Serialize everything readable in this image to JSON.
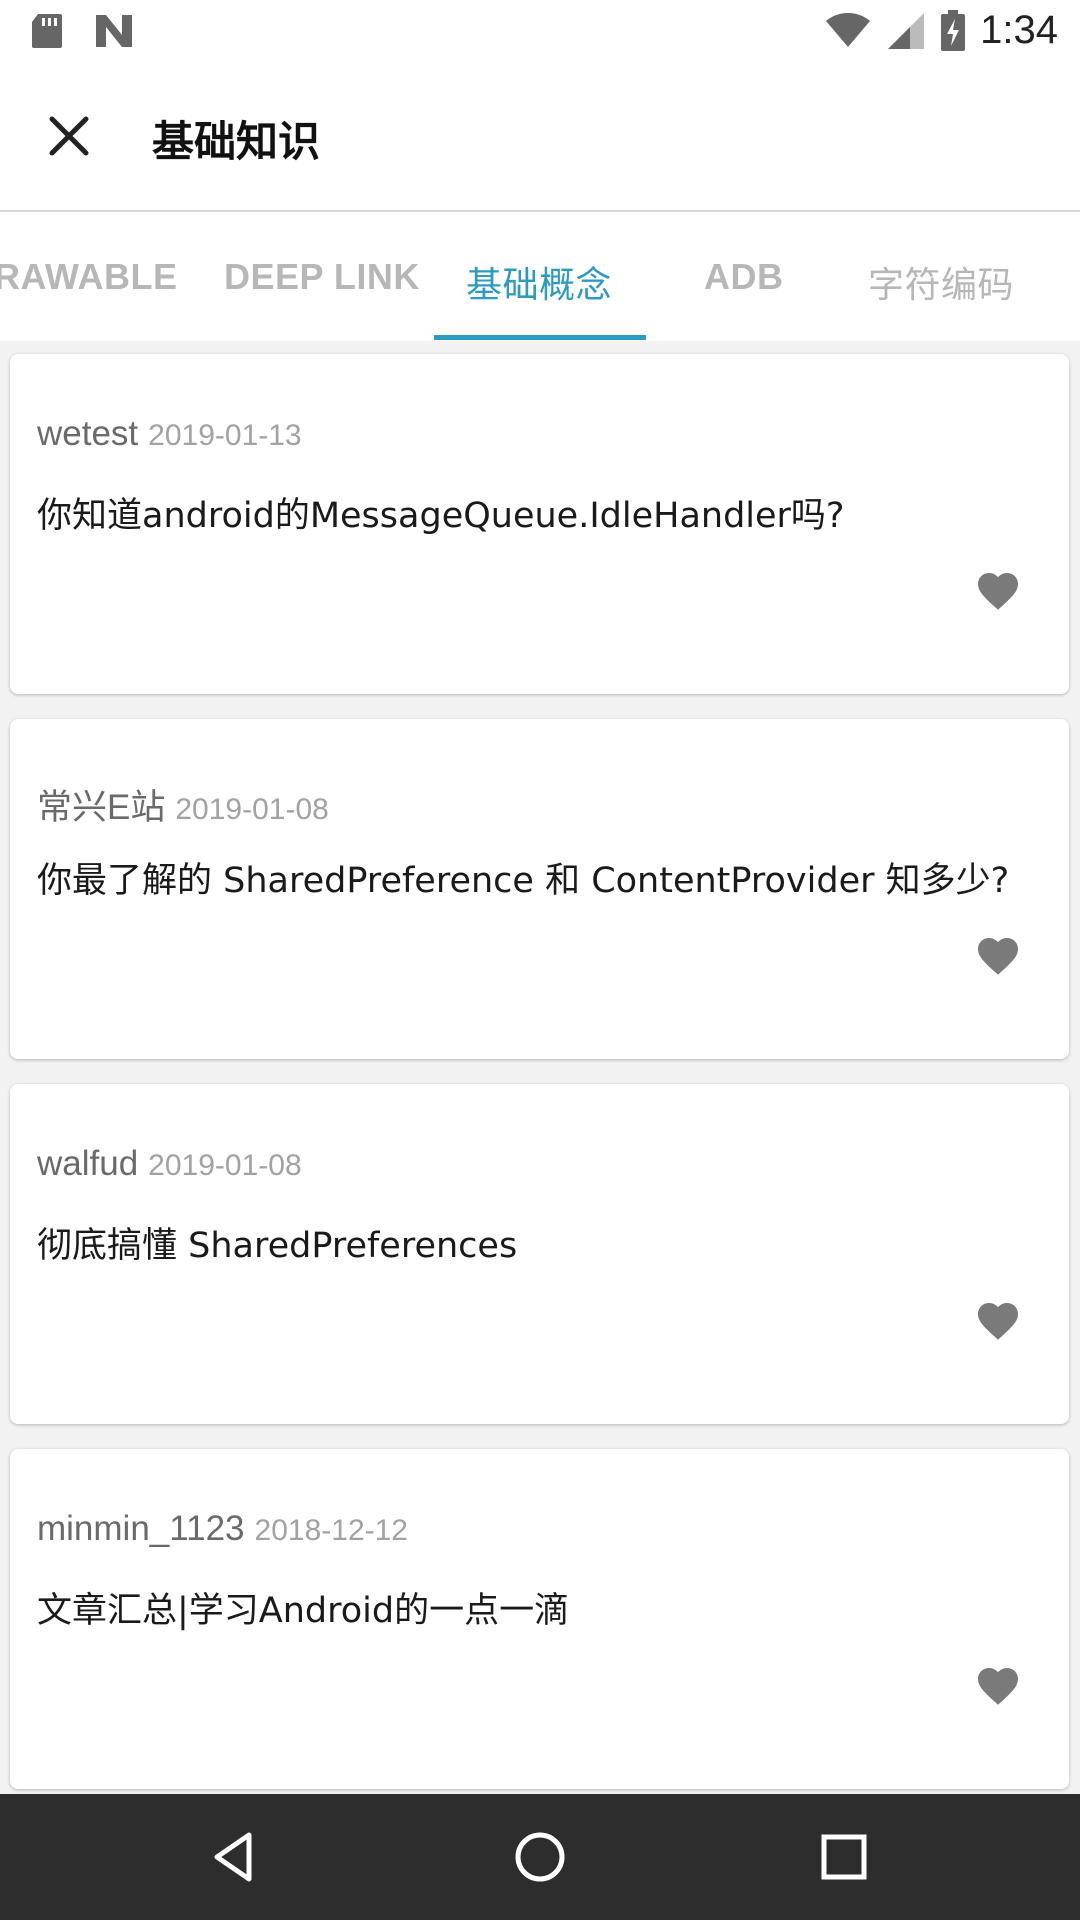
{
  "status_bar": {
    "time": "1:34",
    "icons": [
      "sd-card-icon",
      "n-logo-icon",
      "wifi-icon",
      "cell-signal-icon",
      "battery-charging-icon"
    ]
  },
  "app_bar": {
    "title": "基础知识",
    "close_icon": "close-icon"
  },
  "tabs": [
    {
      "label": "RAWABLE",
      "active": false
    },
    {
      "label": "DEEP LINK",
      "active": false
    },
    {
      "label": "基础概念",
      "active": true
    },
    {
      "label": "ADB",
      "active": false
    },
    {
      "label": "字符编码",
      "active": false
    }
  ],
  "colors": {
    "accent": "#2d9bc0",
    "tab_inactive": "#b7b7b7",
    "heart": "#7a7a7a",
    "nav_bar": "#2d2d2d"
  },
  "articles": [
    {
      "author": "wetest",
      "date": "2019-01-13",
      "title": "你知道android的MessageQueue.IdleHandler吗?"
    },
    {
      "author": "常兴E站",
      "date": "2019-01-08",
      "title": "你最了解的 SharedPreference 和 ContentProvider 知多少?"
    },
    {
      "author": "walfud",
      "date": "2019-01-08",
      "title": "彻底搞懂 SharedPreferences"
    },
    {
      "author": "minmin_1123",
      "date": "2018-12-12",
      "title": "文章汇总|学习Android的一点一滴"
    }
  ],
  "nav_bar": {
    "icons": [
      "back-icon",
      "home-icon",
      "recents-icon"
    ]
  }
}
